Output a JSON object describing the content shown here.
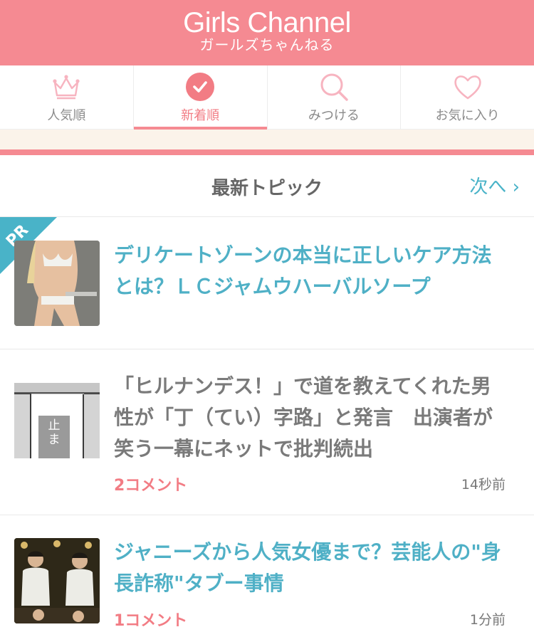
{
  "header": {
    "logo_en": "Girls Channel",
    "logo_jp": "ガールズちゃんねる"
  },
  "nav": {
    "tabs": [
      {
        "label": "人気順",
        "icon": "crown-icon"
      },
      {
        "label": "新着順",
        "icon": "check-circle-icon",
        "active": true
      },
      {
        "label": "みつける",
        "icon": "search-icon"
      },
      {
        "label": "お気に入り",
        "icon": "heart-icon"
      }
    ]
  },
  "section": {
    "title": "最新トピック",
    "next_label": "次へ ›"
  },
  "articles": [
    {
      "title": "デリケートゾーンの本当に正しいケア方法とは？ＬＣジャムウハーバルソープ",
      "badge": "PR"
    },
    {
      "title": "「ヒルナンデス！」で道を教えてくれた男性が「丁（てい）字路」と発言　出演者が笑う一幕にネットで批判続出",
      "comments": "2コメント",
      "time": "14秒前",
      "thumb_text": "止ま"
    },
    {
      "title": "ジャニーズから人気女優まで？芸能人の\"身長詐称\"タブー事情",
      "comments": "1コメント",
      "time": "1分前"
    }
  ],
  "colors": {
    "brand_pink": "#f58a92",
    "link_teal": "#49b3c8",
    "beige": "#fbf3ea"
  }
}
